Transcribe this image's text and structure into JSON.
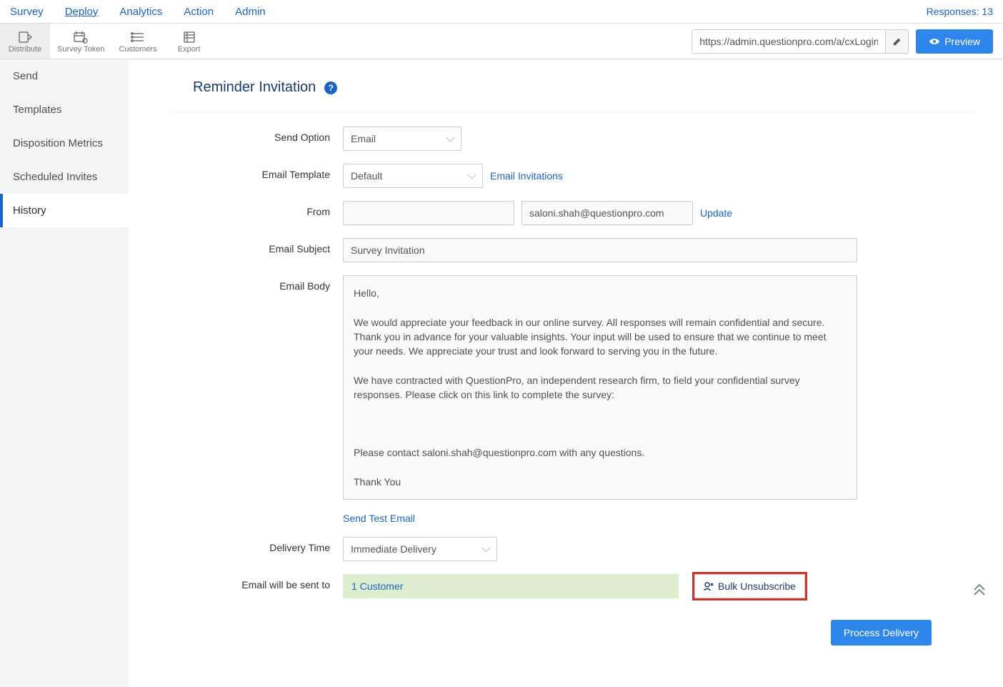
{
  "topnav": {
    "items": [
      "Survey",
      "Deploy",
      "Analytics",
      "Action",
      "Admin"
    ],
    "active_index": 1,
    "responses_label": "Responses: 13"
  },
  "toolbar": {
    "items": [
      {
        "label": "Distribute",
        "icon": "distribute-icon"
      },
      {
        "label": "Survey Token",
        "icon": "calendar-token-icon"
      },
      {
        "label": "Customers",
        "icon": "customers-icon"
      },
      {
        "label": "Export",
        "icon": "export-icon"
      }
    ],
    "active_index": 0,
    "url_value": "https://admin.questionpro.com/a/cxLogin.do",
    "preview_label": "Preview"
  },
  "sidebar": {
    "items": [
      "Send",
      "Templates",
      "Disposition Metrics",
      "Scheduled Invites",
      "History"
    ],
    "active_index": 4
  },
  "page": {
    "title": "Reminder Invitation"
  },
  "form": {
    "send_option_label": "Send Option",
    "send_option_value": "Email",
    "template_label": "Email Template",
    "template_value": "Default",
    "email_invitations_link": "Email Invitations",
    "from_label": "From",
    "from_blank": "",
    "from_email": "saloni.shah@questionpro.com",
    "update_link": "Update",
    "subject_label": "Email Subject",
    "subject_value": "Survey Invitation",
    "body_label": "Email Body",
    "body_text": "Hello,\n\nWe would appreciate your feedback in our online survey. All responses will remain confidential and secure. Thank you in advance for your valuable insights. Your input will be used to ensure that we continue to meet your needs. We appreciate your trust and look forward to serving you in the future.\n\nWe have contracted with QuestionPro, an independent research firm, to field your confidential survey responses. Please click on this link to complete the survey:\n\n\n\nPlease contact saloni.shah@questionpro.com with any questions.\n\nThank You",
    "send_test_link": "Send Test Email",
    "delivery_label": "Delivery Time",
    "delivery_value": "Immediate Delivery",
    "sent_to_label": "Email will be sent to",
    "sent_to_value": "1 Customer",
    "bulk_unsubscribe_label": "Bulk Unsubscribe",
    "process_label": "Process Delivery"
  }
}
